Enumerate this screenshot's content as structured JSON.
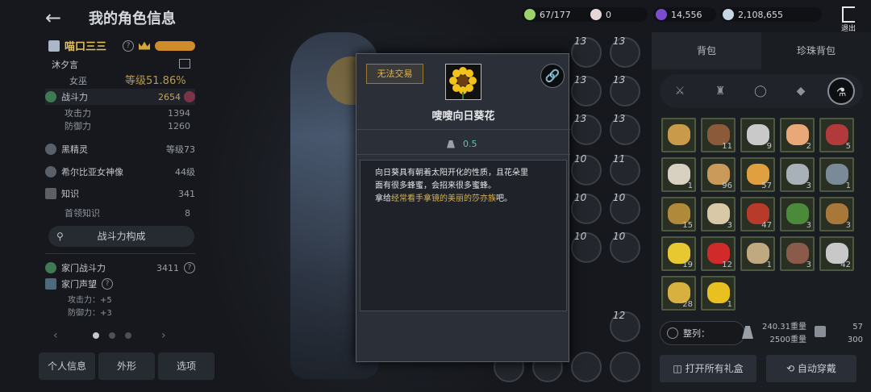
{
  "header": {
    "back_icon": "back-arrow-icon",
    "title": "我的角色信息"
  },
  "resources": [
    {
      "name": "energy",
      "value": "67/177",
      "color": "#9bd26c",
      "icon": "energy-icon"
    },
    {
      "name": "pearl",
      "value": "0",
      "color": "#e6d6d8",
      "icon": "pearl-icon"
    },
    {
      "name": "black-gem",
      "value": "14,556",
      "color": "#7b4bd0",
      "icon": "gem-icon"
    },
    {
      "name": "silver",
      "value": "2,108,655",
      "color": "#c7d6e4",
      "icon": "silver-coin-icon"
    }
  ],
  "exit_label": "退出",
  "profile": {
    "name": "喵口三三",
    "sub_name": "沐夕言",
    "class": "女巫",
    "level": "等级51.86%",
    "combat_label": "战斗力",
    "combat_value": "2654",
    "attack_label": "攻击力",
    "attack_value": "1394",
    "defense_label": "防御力",
    "defense_value": "1260",
    "black_spirit_label": "黑精灵",
    "black_spirit_value": "等级73",
    "goddess_label": "希尔比亚女神像",
    "goddess_value": "44级",
    "knowledge_label": "知识",
    "knowledge_value": "341",
    "first_knowledge_label": "首领知识",
    "first_knowledge_value": "8",
    "combat_build_button": "战斗力构成",
    "family_combat_label": "家门战斗力",
    "family_combat_value": "3411",
    "family_fame_label": "家门声望",
    "family_attack": "攻击力：+5",
    "family_defense": "防御力：+3"
  },
  "bottom_tabs": [
    "个人信息",
    "外形",
    "选项"
  ],
  "popup": {
    "tradable_tag": "无法交易",
    "item_name": "嗖嗖向日葵花",
    "weight": "0.5",
    "desc_line1": "向日葵具有朝着太阳开化的性质，且花朵里",
    "desc_line2": "面有很多蜂蜜，会招来很多蜜蜂。",
    "desc_line3_prefix": "拿给",
    "desc_line3_highlight": "经常看手拿镜的美丽的莎亦族",
    "desc_line3_suffix": "吧。"
  },
  "slots": [
    {
      "n": "13"
    },
    {
      "n": "13"
    },
    {
      "n": "13"
    },
    {
      "n": "13"
    },
    {
      "n": "13"
    },
    {
      "n": "13"
    },
    {
      "n": "10"
    },
    {
      "n": "11"
    },
    {
      "n": "10"
    },
    {
      "n": "10"
    },
    {
      "n": "10"
    },
    {
      "n": "10"
    },
    {
      "n": "12"
    }
  ],
  "inventory": {
    "tabs": [
      "背包",
      "珍珠背包"
    ],
    "filters": [
      "crossed-swords-icon",
      "armor-icon",
      "ring-icon",
      "gem-icon",
      "potion-icon"
    ],
    "items": [
      {
        "count": "",
        "color": "#c89a4a"
      },
      {
        "count": "11",
        "color": "#8a5a3a"
      },
      {
        "count": "9",
        "color": "#c9c9c9"
      },
      {
        "count": "2",
        "color": "#e8a878"
      },
      {
        "count": "5",
        "color": "#b23a3a"
      },
      {
        "count": "1",
        "color": "#d8d0c0"
      },
      {
        "count": "96",
        "color": "#c99a5a"
      },
      {
        "count": "57",
        "color": "#e0a040"
      },
      {
        "count": "3",
        "color": "#a8b0b8"
      },
      {
        "count": "1",
        "color": "#7a8a98"
      },
      {
        "count": "15",
        "color": "#b08a3a"
      },
      {
        "count": "3",
        "color": "#d8c8a8"
      },
      {
        "count": "47",
        "color": "#b83a2a"
      },
      {
        "count": "3",
        "color": "#4a8a3a"
      },
      {
        "count": "3",
        "color": "#a8783a"
      },
      {
        "count": "19",
        "color": "#e8c830"
      },
      {
        "count": "12",
        "color": "#d02a2a"
      },
      {
        "count": "1",
        "color": "#c0a880"
      },
      {
        "count": "3",
        "color": "#8a5a4a"
      },
      {
        "count": "42",
        "color": "#c8c8c8"
      },
      {
        "count": "28",
        "color": "#d8b040"
      },
      {
        "count": "1",
        "color": "#e8c020"
      }
    ],
    "sort_label": "整列：",
    "weight_text": "240.31重量",
    "weight_max": "2500重量",
    "slot_used": "57",
    "slot_max": "300",
    "open_gifts": "打开所有礼盒",
    "auto_equip": "自动穿戴"
  }
}
